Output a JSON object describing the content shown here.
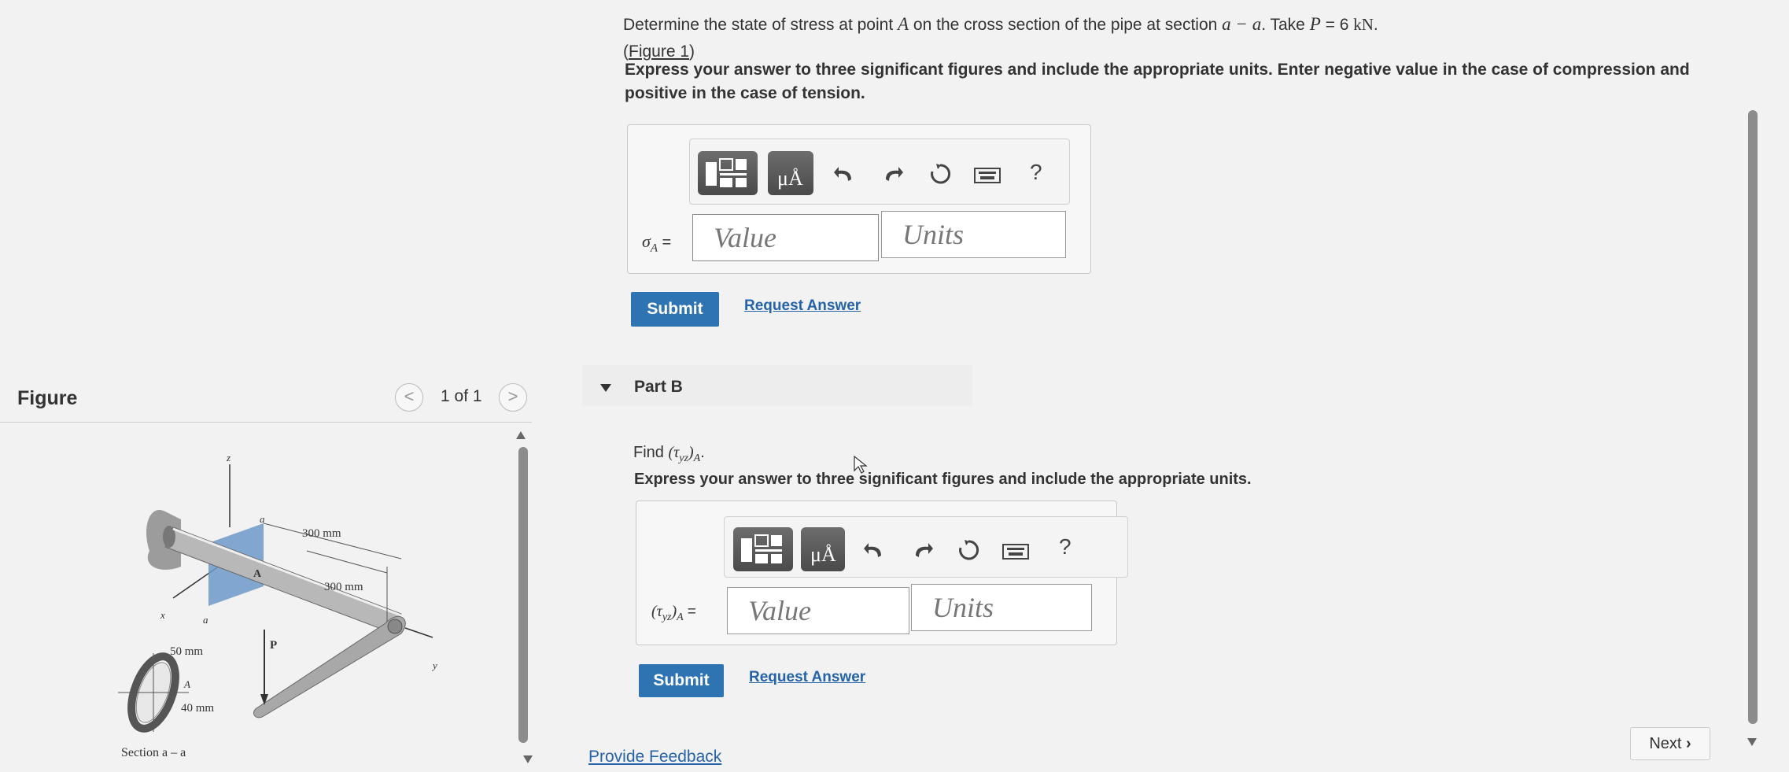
{
  "partA": {
    "question_before": "Determine the state of stress at point",
    "point": "A",
    "question_mid": "on the cross section of the pipe at section",
    "section": "a − a",
    "question_take": ". Take",
    "param": "P",
    "param_eq": "= 6",
    "param_unit": "kN",
    "param_end": ".",
    "figure_link": "Figure 1",
    "instruction": "Express your answer to three significant figures and include the appropriate units. Enter negative value in the case of compression and positive in the case of tension.",
    "answer_label": "σ",
    "answer_label_sub": "A",
    "answer_label_eq": "=",
    "value_placeholder": "Value",
    "units_placeholder": "Units",
    "submit_label": "Submit",
    "request_label": "Request Answer"
  },
  "partB": {
    "header": "Part B",
    "find_text": "Find",
    "find_math": "(τ",
    "find_sub": "yz",
    "find_close": ")",
    "find_sub2": "A",
    "find_end": ".",
    "instruction": "Express your answer to three significant figures and include the appropriate units.",
    "answer_label": "(τ",
    "answer_label_sub": "yz",
    "answer_label_close": ")",
    "answer_label_sub2": "A",
    "answer_label_eq": "=",
    "value_placeholder": "Value",
    "units_placeholder": "Units",
    "submit_label": "Submit",
    "request_label": "Request Answer"
  },
  "toolbar": {
    "units_symbol": "μÅ",
    "help_symbol": "?"
  },
  "figure": {
    "title": "Figure",
    "counter": "1 of 1",
    "prev": "<",
    "next": ">",
    "labels": {
      "z": "z",
      "a_top": "a",
      "dim1": "300 mm",
      "A": "A",
      "dim2": "300 mm",
      "x": "x",
      "a_bottom": "a",
      "d50": "50 mm",
      "P": "P",
      "y": "y",
      "A2": "A",
      "d40": "40 mm",
      "section": "Section a – a"
    }
  },
  "footer": {
    "feedback": "Provide Feedback",
    "next": "Next"
  }
}
